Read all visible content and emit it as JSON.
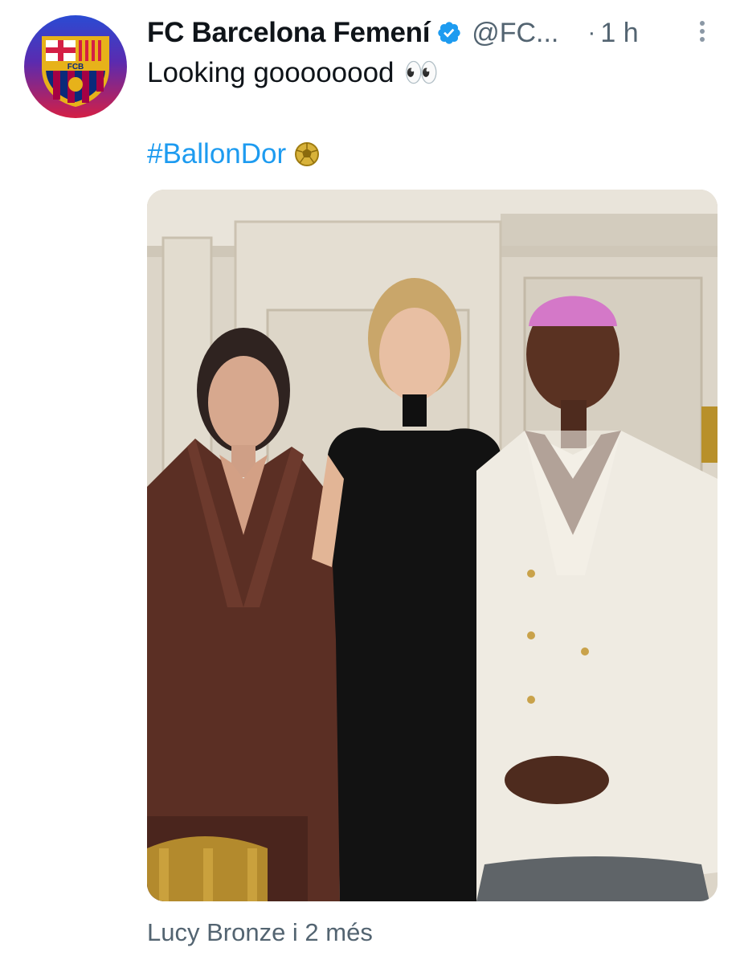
{
  "account": {
    "display_name": "FC Barcelona Femení",
    "handle": "@FC...",
    "separator": "·",
    "time": "1 h",
    "verified": true,
    "avatar_icon": "fcb-crest-icon",
    "avatar_crest_text": "FCB"
  },
  "tweet": {
    "text": "Looking goooooood",
    "emoji": "👀",
    "hashtag": "#BallonDor",
    "hashtag_emoji_icon": "golden-ball-icon"
  },
  "media": {
    "type": "photo"
  },
  "tagged_people": "Lucy Bronze i 2 més",
  "colors": {
    "link": "#1d9bf0",
    "secondary_text": "#536471",
    "primary_text": "#0f1419",
    "verified": "#1d9bf0"
  }
}
